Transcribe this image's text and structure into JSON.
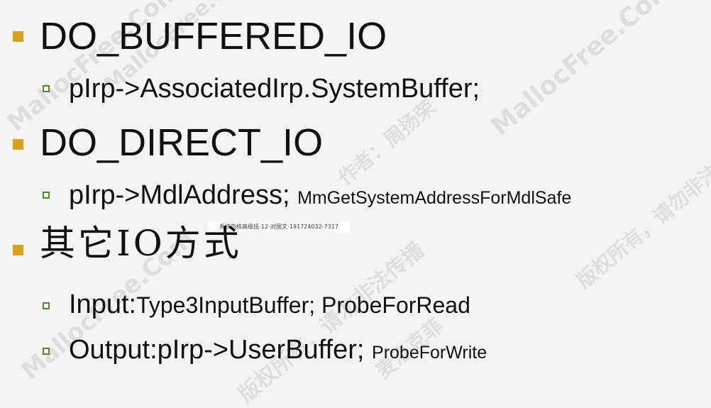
{
  "watermark": {
    "brand": "MallocFree.Com",
    "notice_a": "版权所有，请勿非法传播",
    "notice_b": "作者：周扬荣",
    "notice_c": "麦洛克菲"
  },
  "items": {
    "buffered": {
      "title": "DO_BUFFERED_IO",
      "sub": "pIrp->AssociatedIrp.SystemBuffer;"
    },
    "direct": {
      "title": "DO_DIRECT_IO",
      "sub": "pIrp->MdlAddress;",
      "sub_note": "MmGetSystemAddressForMdlSafe"
    },
    "other": {
      "title": "其它IO方式",
      "input_label": "Input:",
      "input_value": "Type3InputBuffer; ProbeForRead",
      "output_label": "Output:pIrp->UserBuffer;",
      "output_note": "ProbeForWrite"
    }
  },
  "caption": "系统内核高级班-12-对国文-191724032-7317"
}
